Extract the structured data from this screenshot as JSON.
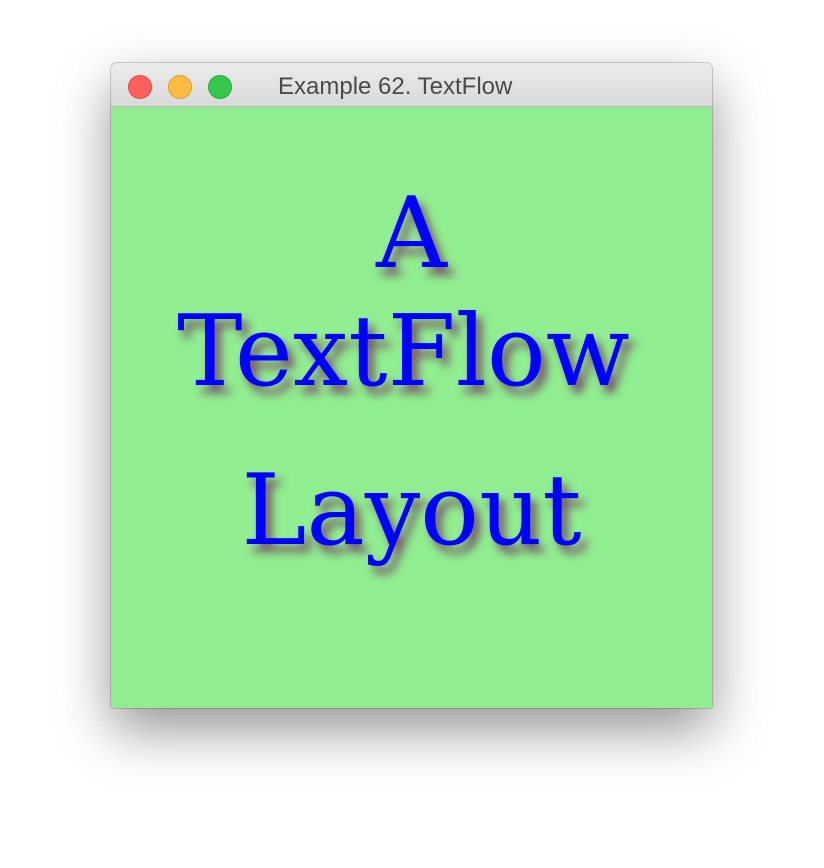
{
  "window": {
    "title": "Example 62. TextFlow",
    "controls": {
      "close": "close-button",
      "minimize": "minimize-button",
      "zoom": "zoom-button"
    }
  },
  "content": {
    "background_color": "#90ee90",
    "text_color": "#0000ff",
    "shadow_color": "#7a2a6a",
    "lines": [
      {
        "text": "A"
      },
      {
        "text": "TextFlow"
      },
      {
        "text": "Layout"
      }
    ]
  }
}
